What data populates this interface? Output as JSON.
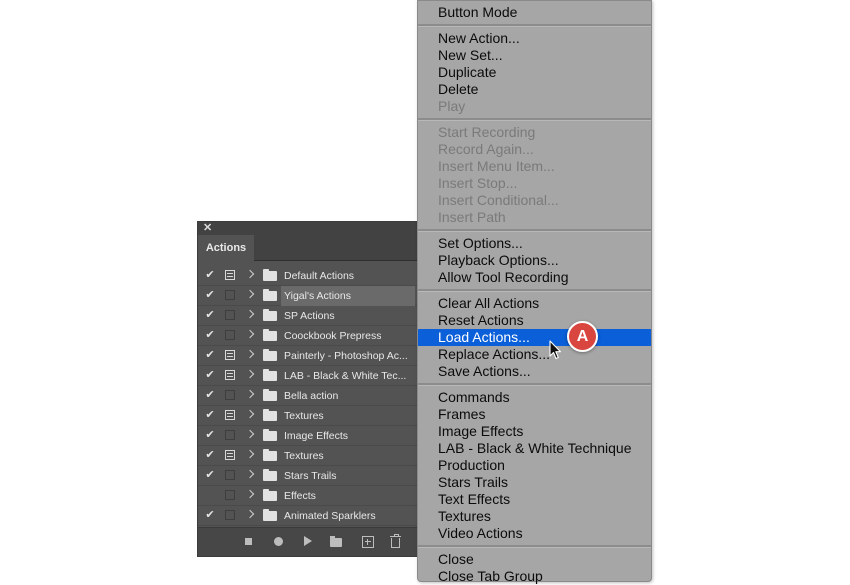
{
  "panel": {
    "tab_label": "Actions",
    "close_glyph": "✕",
    "rows": [
      {
        "name": "Default Actions",
        "checked": true,
        "dialog": true
      },
      {
        "name": "Yigal's Actions",
        "checked": true,
        "dialog": false,
        "selected": true
      },
      {
        "name": "SP Actions",
        "checked": true,
        "dialog": false
      },
      {
        "name": "Coockbook Prepress",
        "checked": true,
        "dialog": false
      },
      {
        "name": "Painterly - Photoshop Ac...",
        "checked": true,
        "dialog": true
      },
      {
        "name": "LAB - Black & White Tec...",
        "checked": true,
        "dialog": true
      },
      {
        "name": "Bella action",
        "checked": true,
        "dialog": false
      },
      {
        "name": "Textures",
        "checked": true,
        "dialog": true
      },
      {
        "name": "Image Effects",
        "checked": true,
        "dialog": false
      },
      {
        "name": "Textures",
        "checked": true,
        "dialog": true
      },
      {
        "name": "Stars Trails",
        "checked": true,
        "dialog": false
      },
      {
        "name": "Effects",
        "checked": false,
        "dialog": false
      },
      {
        "name": "Animated Sparklers",
        "checked": true,
        "dialog": false
      }
    ],
    "footer_icons": [
      "stop-icon",
      "record-icon",
      "play-icon",
      "new-set-icon",
      "new-action-icon",
      "trash-icon"
    ]
  },
  "menu": {
    "groups": [
      [
        {
          "label": "Button Mode"
        }
      ],
      [
        {
          "label": "New Action..."
        },
        {
          "label": "New Set..."
        },
        {
          "label": "Duplicate"
        },
        {
          "label": "Delete"
        },
        {
          "label": "Play",
          "disabled": true
        }
      ],
      [
        {
          "label": "Start Recording",
          "disabled": true
        },
        {
          "label": "Record Again...",
          "disabled": true
        },
        {
          "label": "Insert Menu Item...",
          "disabled": true
        },
        {
          "label": "Insert Stop...",
          "disabled": true
        },
        {
          "label": "Insert Conditional...",
          "disabled": true
        },
        {
          "label": "Insert Path",
          "disabled": true
        }
      ],
      [
        {
          "label": "Set Options..."
        },
        {
          "label": "Playback Options..."
        },
        {
          "label": "Allow Tool Recording"
        }
      ],
      [
        {
          "label": "Clear All Actions"
        },
        {
          "label": "Reset Actions"
        },
        {
          "label": "Load Actions...",
          "highlight": true
        },
        {
          "label": "Replace Actions..."
        },
        {
          "label": "Save Actions..."
        }
      ],
      [
        {
          "label": "Commands"
        },
        {
          "label": "Frames"
        },
        {
          "label": "Image Effects"
        },
        {
          "label": "LAB - Black & White Technique"
        },
        {
          "label": "Production"
        },
        {
          "label": "Stars Trails"
        },
        {
          "label": "Text Effects"
        },
        {
          "label": "Textures"
        },
        {
          "label": "Video Actions"
        }
      ],
      [
        {
          "label": "Close"
        },
        {
          "label": "Close Tab Group"
        }
      ]
    ]
  },
  "annotation": {
    "badge_label": "A",
    "badge_color": "#d9453f"
  },
  "colors": {
    "highlight": "#0b5fd8",
    "menu_bg": "#a6a6a6",
    "panel_bg": "#535353"
  }
}
